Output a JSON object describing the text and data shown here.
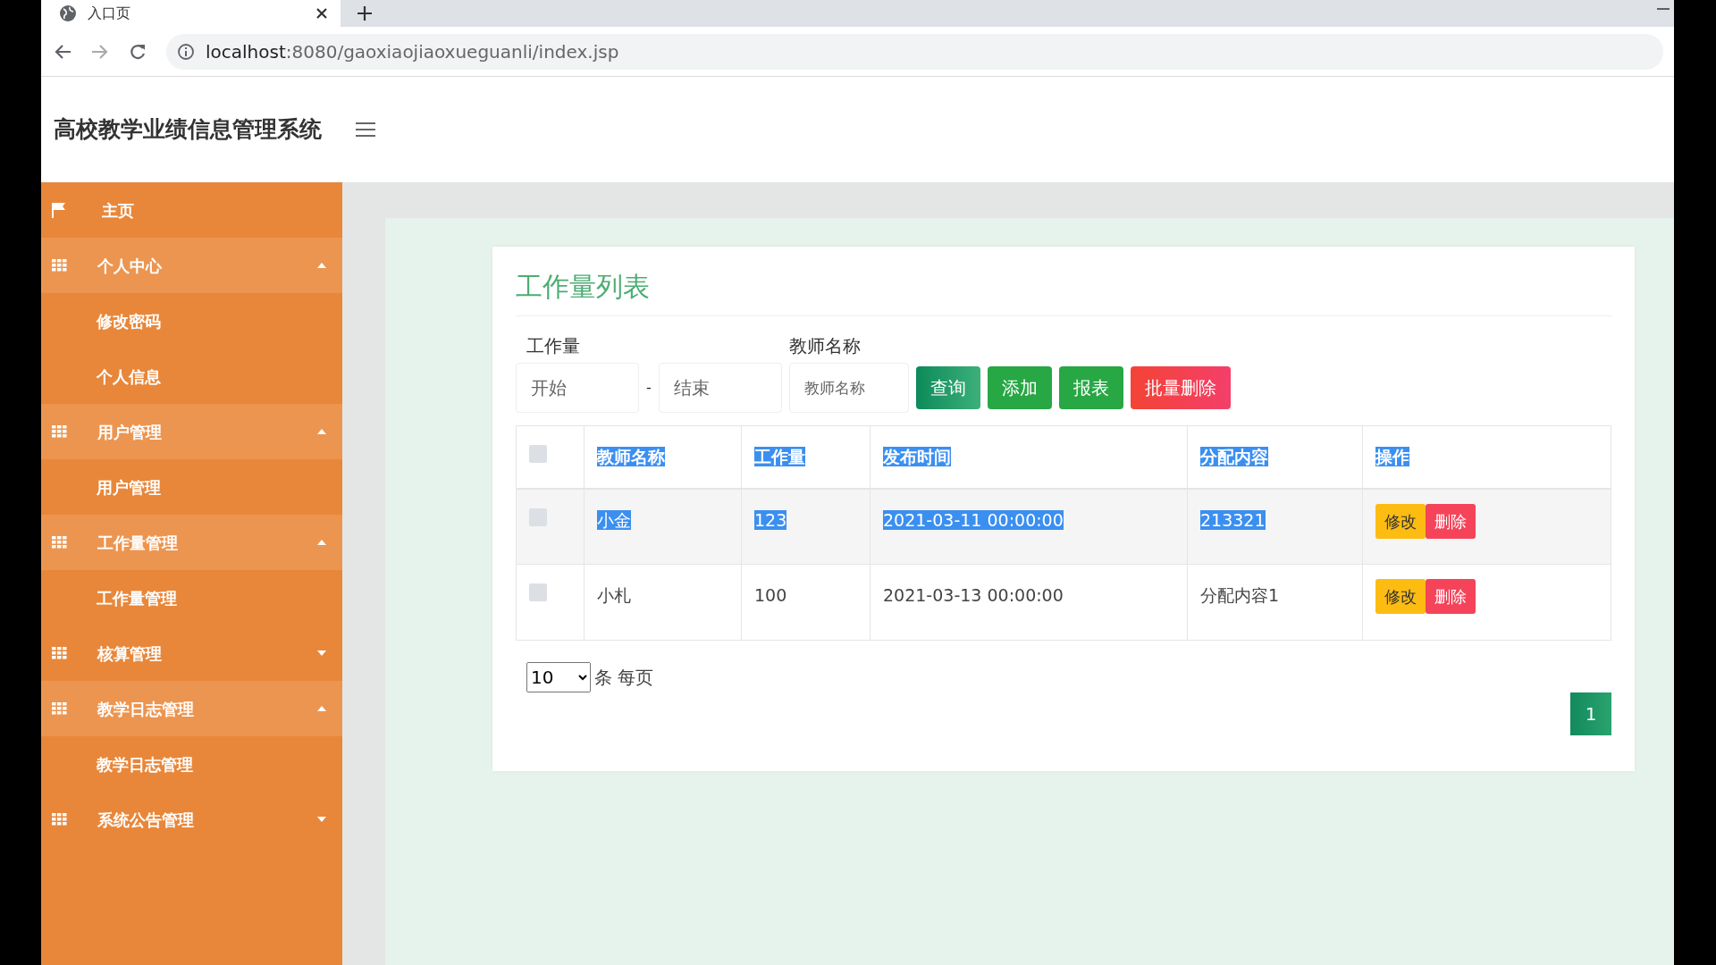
{
  "browser": {
    "tab_title": "入口页",
    "url_host": "localhost",
    "url_rest": ":8080/gaoxiaojiaoxueguanli/index.jsp"
  },
  "header": {
    "title": "高校教学业绩信息管理系统"
  },
  "sidebar": {
    "items": [
      {
        "label": "主页",
        "kind": "link"
      },
      {
        "label": "个人中心",
        "kind": "group",
        "expanded": true,
        "children": [
          {
            "label": "修改密码"
          },
          {
            "label": "个人信息"
          }
        ]
      },
      {
        "label": "用户管理",
        "kind": "group",
        "expanded": true,
        "children": [
          {
            "label": "用户管理"
          }
        ]
      },
      {
        "label": "工作量管理",
        "kind": "group",
        "expanded": true,
        "children": [
          {
            "label": "工作量管理"
          }
        ]
      },
      {
        "label": "核算管理",
        "kind": "group",
        "expanded": false
      },
      {
        "label": "教学日志管理",
        "kind": "group",
        "expanded": true,
        "children": [
          {
            "label": "教学日志管理"
          }
        ]
      },
      {
        "label": "系统公告管理",
        "kind": "group",
        "expanded": false
      }
    ]
  },
  "panel": {
    "title": "工作量列表",
    "filters": {
      "range_label": "工作量",
      "from": {
        "placeholder": "开始"
      },
      "separator": "-",
      "to": {
        "placeholder": "结束"
      },
      "name_label": "教师名称",
      "name": {
        "placeholder": "教师名称"
      }
    },
    "buttons": [
      {
        "label": "查询",
        "kind": "search"
      },
      {
        "label": "添加",
        "kind": "add"
      },
      {
        "label": "报表",
        "kind": "report"
      },
      {
        "label": "批量删除",
        "kind": "delete"
      }
    ],
    "table": {
      "header_highlighted": true,
      "select_all_checked": false,
      "columns": [
        "教师名称",
        "工作量",
        "发布时间",
        "分配内容",
        "操作"
      ],
      "rows": [
        {
          "checked": false,
          "highlighted": true,
          "cells": [
            "小金",
            "123",
            "2021-03-11 00:00:00",
            "213321"
          ],
          "actions": [
            "修改",
            "删除"
          ]
        },
        {
          "checked": false,
          "highlighted": false,
          "cells": [
            "小札",
            "100",
            "2021-03-13 00:00:00",
            "分配内容1"
          ],
          "actions": [
            "修改",
            "删除"
          ]
        }
      ]
    },
    "page_size": "10",
    "page_size_label": "条 每页",
    "pages": [
      {
        "label": "1",
        "selected": true
      }
    ]
  }
}
